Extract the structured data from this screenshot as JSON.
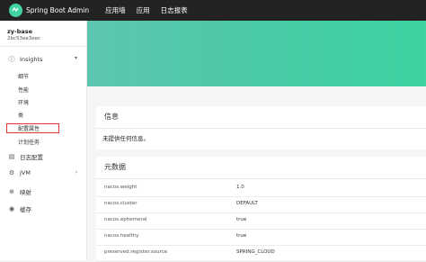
{
  "topbar": {
    "brand": "Spring Boot Admin",
    "nav": [
      "应用墙",
      "应用",
      "日志报表"
    ]
  },
  "sidebar": {
    "app_name": "zy-base",
    "app_id": "2bc53ee3eec",
    "insights": "Insights",
    "insight_items": [
      "细节",
      "性能",
      "环境",
      "类",
      "配置属性",
      "计划任务"
    ],
    "bottom_items": [
      "日志配置",
      "JVM",
      "映射",
      "缓存"
    ]
  },
  "info_card": {
    "title": "信息",
    "body": "未提供任何信息。"
  },
  "meta_card": {
    "title": "元数据",
    "rows": [
      {
        "key": "nacos.weight",
        "value": "1.0"
      },
      {
        "key": "nacos.cluster",
        "value": "DEFAULT"
      },
      {
        "key": "nacos.ephemeral",
        "value": "true"
      },
      {
        "key": "nacos.healthy",
        "value": "true"
      },
      {
        "key": "preserved.register.source",
        "value": "SPRING_CLOUD"
      }
    ]
  }
}
